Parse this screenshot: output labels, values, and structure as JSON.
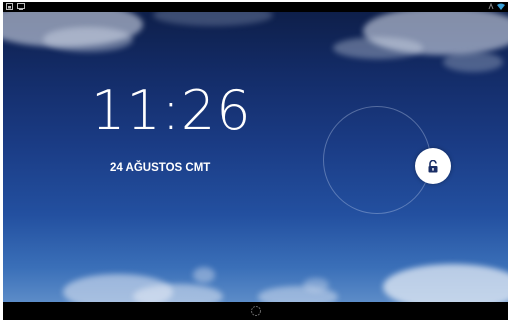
{
  "lockscreen": {
    "time": "11:26",
    "date": "24 AĞUSTOS CMT"
  },
  "icons": {
    "status_left": [
      "image-icon",
      "screen-icon"
    ],
    "status_right": [
      "no-signal-icon",
      "wifi-icon"
    ],
    "unlock": "unlock-icon",
    "home": "home-icon"
  },
  "colors": {
    "accent_wifi": "#3aa0d8",
    "text": "#ffffff"
  }
}
